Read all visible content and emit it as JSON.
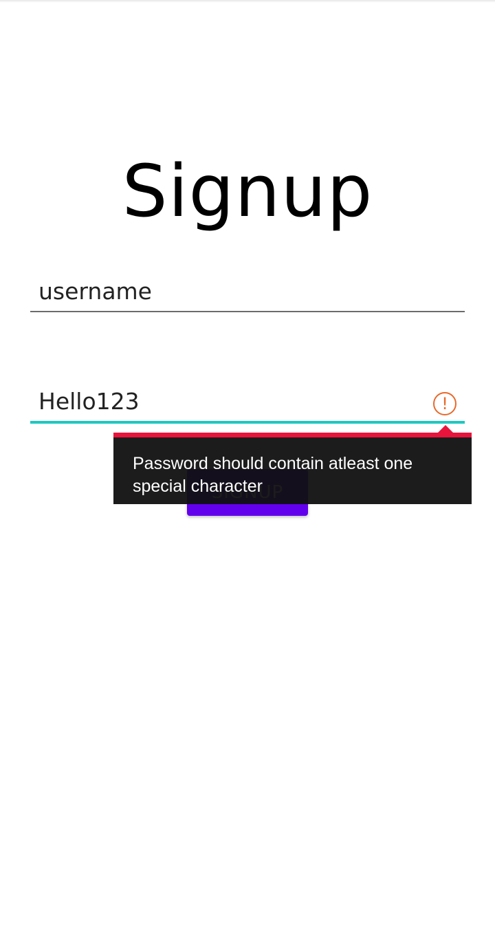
{
  "screen": {
    "title": "Signup"
  },
  "form": {
    "username": {
      "value": "username"
    },
    "password": {
      "value": "Hello123",
      "error_icon": "!"
    },
    "submit_label": "Signup"
  },
  "error_popup": {
    "message": "Password should contain atleast one special character"
  },
  "colors": {
    "focus_underline": "#1ec8c0",
    "error_icon": "#e8692a",
    "error_accent": "#e8143c",
    "button": "#6200ee"
  },
  "icons": {
    "password_error": "alert-circle-icon"
  }
}
